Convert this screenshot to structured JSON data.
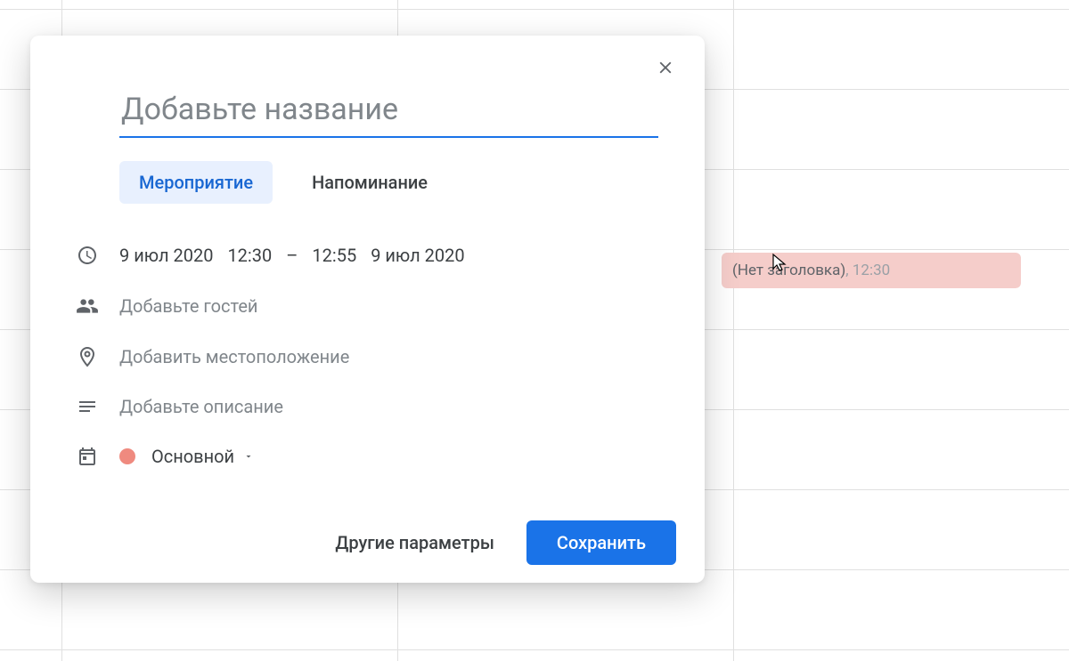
{
  "modal": {
    "title_placeholder": "Добавьте название",
    "tabs": {
      "event": "Мероприятие",
      "reminder": "Напоминание"
    },
    "date_start": "9 июл 2020",
    "time_start": "12:30",
    "time_end": "12:55",
    "date_end": "9 июл 2020",
    "guests_placeholder": "Добавьте гостей",
    "location_placeholder": "Добавить местоположение",
    "description_placeholder": "Добавьте описание",
    "calendar_name": "Основной",
    "calendar_color": "#ef8a7f",
    "more_options": "Другие параметры",
    "save": "Сохранить"
  },
  "event_block": {
    "title": "(Нет заголовка)",
    "time": "12:30"
  },
  "colors": {
    "primary": "#1a73e8"
  }
}
